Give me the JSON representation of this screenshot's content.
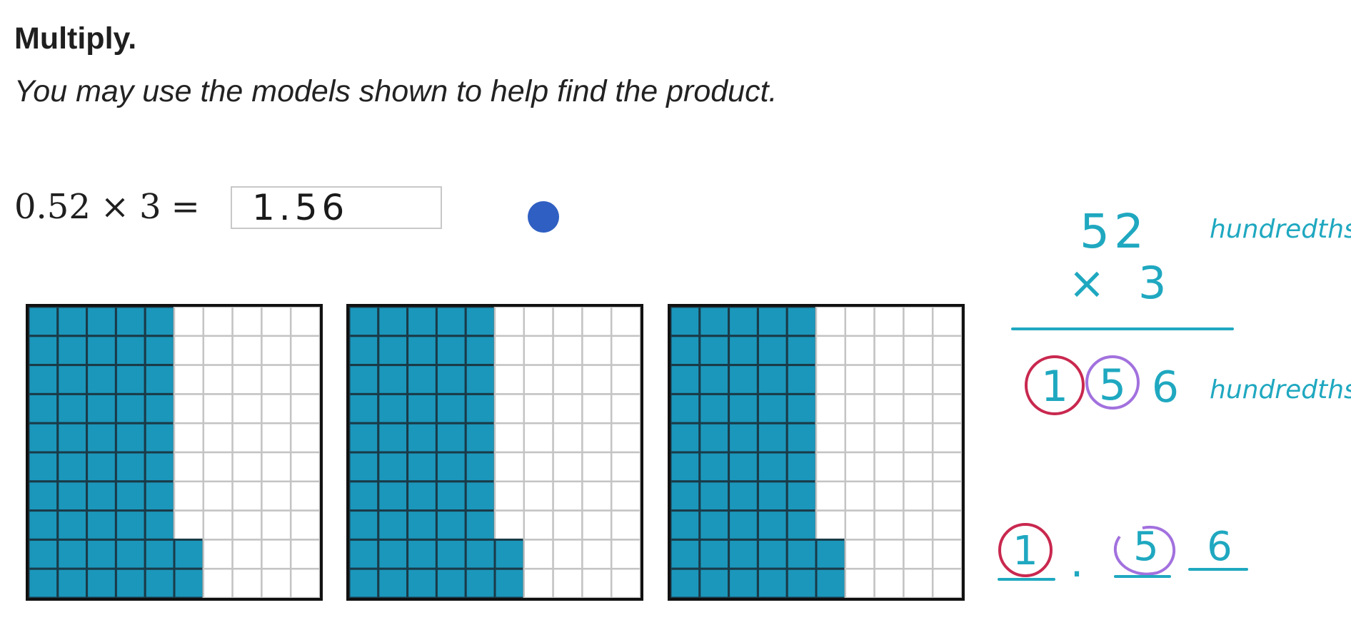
{
  "prompt": {
    "title": "Multiply.",
    "instructions": "You may use the models shown to help find the product."
  },
  "equation": {
    "factor_a": "0.52",
    "times": "×",
    "factor_b": "3",
    "equals": "=",
    "answer_value": "1.56"
  },
  "models": [
    {
      "shaded_hundredths": 52
    },
    {
      "shaded_hundredths": 52
    },
    {
      "shaded_hundredths": 52
    }
  ],
  "colors": {
    "shaded": "#1b97bb",
    "grid_line_shaded": "#1a3a48",
    "grid_line_empty": "#c4c4c4",
    "border": "#111111",
    "cursor": "#2f5fc2",
    "ink_teal": "#1fa8c0",
    "ink_red": "#c9284f",
    "ink_purple": "#a271de"
  },
  "handwritten_notes": {
    "top_number": "52",
    "top_unit": "hundredths",
    "multiplier_sign": "×",
    "multiplier": "3",
    "product_digits": [
      "1",
      "5",
      "6"
    ],
    "product_unit": "hundredths",
    "decimal_digits": [
      "1",
      "5",
      "6"
    ],
    "decimal_point": "."
  }
}
